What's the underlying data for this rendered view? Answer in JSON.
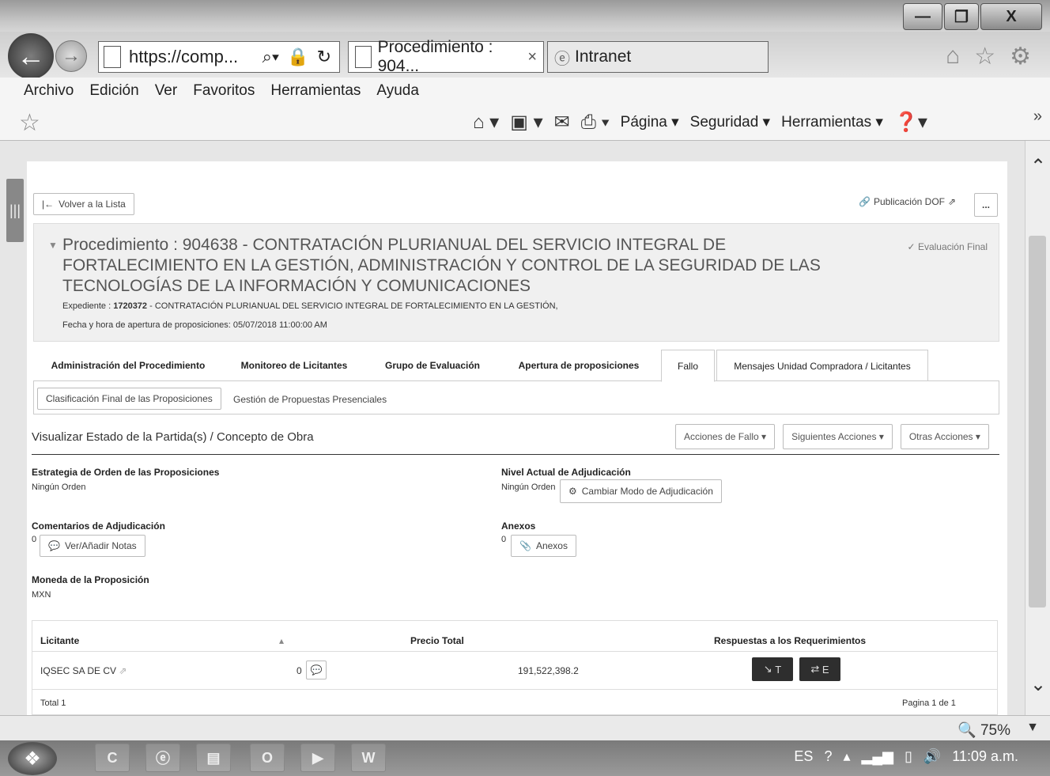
{
  "browser": {
    "url_text": "https://comp...",
    "tab_active": "Procedimiento : 904...",
    "tab_active_close": "×",
    "tab_other": "Intranet",
    "window_minimize": "—",
    "window_maximize": "❐",
    "window_close": "X"
  },
  "menu": [
    "Archivo",
    "Edición",
    "Ver",
    "Favoritos",
    "Herramientas",
    "Ayuda"
  ],
  "commands": {
    "pagina": "Página ▾",
    "seguridad": "Seguridad ▾",
    "herramientas": "Herramientas ▾"
  },
  "page": {
    "back_to_list": "Volver a la Lista",
    "publicacion_dof": "Publicación DOF",
    "more": "...",
    "procedure_title": "Procedimiento : 904638 - CONTRATACIÓN PLURIANUAL DEL SERVICIO INTEGRAL DE FORTALECIMIENTO EN LA GESTIÓN, ADMINISTRACIÓN Y CONTROL DE LA SEGURIDAD DE LAS TECNOLOGÍAS DE LA INFORMACIÓN Y COMUNICACIONES",
    "evaluacion_final": "Evaluación Final",
    "expediente_label": "Expediente :",
    "expediente_number": "1720372",
    "expediente_text": " - CONTRATACIÓN PLURIANUAL DEL SERVICIO INTEGRAL DE FORTALECIMIENTO EN LA GESTIÓN,",
    "fecha_label": "Fecha y hora de apertura de proposiciones:",
    "fecha_value": "05/07/2018 11:00:00 AM",
    "tabs": [
      "Administración del Procedimiento",
      "Monitoreo de Licitantes",
      "Grupo de Evaluación",
      "Apertura de proposiciones",
      "Fallo",
      "Mensajes Unidad Compradora / Licitantes"
    ],
    "subtabs": [
      "Clasificación Final de las Proposiciones",
      "Gestión de Propuestas Presenciales"
    ],
    "section_title": "Visualizar Estado de la Partida(s) / Concepto de Obra",
    "actions": [
      "Acciones de Fallo ▾",
      "Siguientes Acciones ▾",
      "Otras Acciones ▾"
    ],
    "estrategia_label": "Estrategia de Orden de las Proposiciones",
    "estrategia_value": "Ningún Orden",
    "nivel_label": "Nivel Actual de Adjudicación",
    "nivel_value": "Ningún Orden",
    "cambiar_modo": "Cambiar Modo de Adjudicación",
    "comentarios_label": "Comentarios de Adjudicación",
    "comentarios_count": "0",
    "ver_notas": "Ver/Añadir Notas",
    "anexos_label": "Anexos",
    "anexos_count": "0",
    "anexos_btn": "Anexos",
    "moneda_label": "Moneda de la Proposición",
    "moneda_value": "MXN",
    "table": {
      "col_licitante": "Licitante",
      "col_precio": "Precio Total",
      "col_respuestas": "Respuestas a los Requerimientos",
      "row_licitante": "IQSEC SA DE CV",
      "row_notes": "0",
      "row_precio": "191,522,398.2",
      "btn_t": "T",
      "btn_e": "E",
      "total": "Total 1",
      "pagina": "Pagina 1 de 1"
    }
  },
  "status": {
    "zoom": "75%"
  },
  "taskbar": {
    "lang": "ES",
    "clock": "11:09 a.m."
  }
}
